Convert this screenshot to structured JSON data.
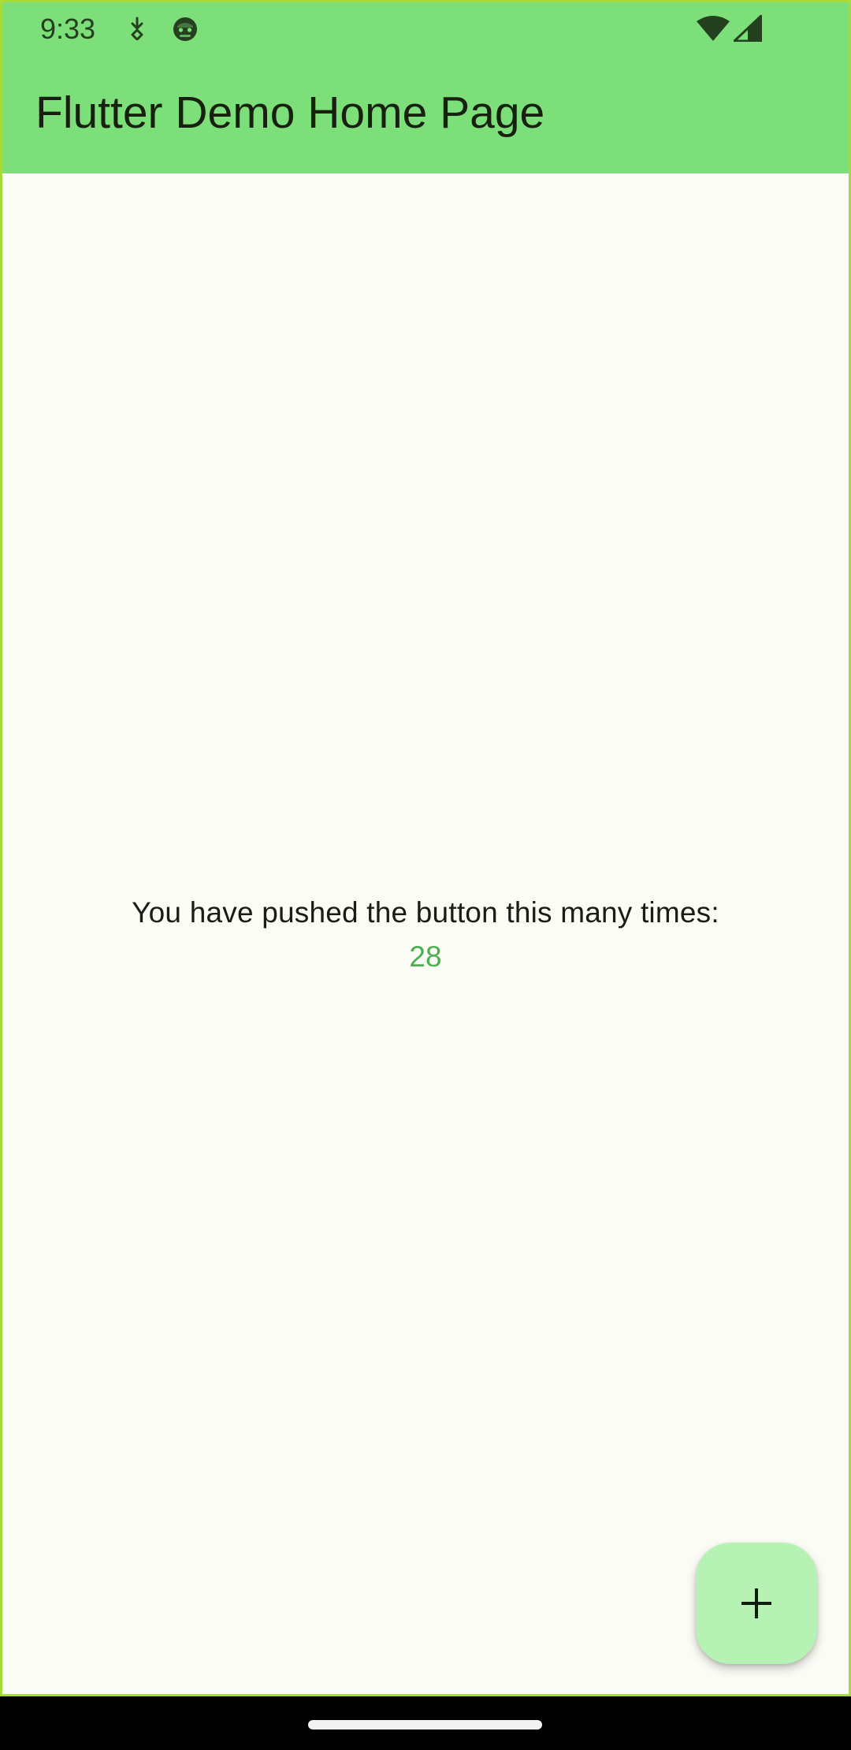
{
  "status_bar": {
    "time": "9:33",
    "notification_icons": [
      "download-arrow-icon",
      "android-robot-icon"
    ],
    "system_icons": [
      "wifi-icon",
      "cellular-signal-icon"
    ]
  },
  "app_bar": {
    "title": "Flutter Demo Home Page",
    "background_color": "#7ddf7a"
  },
  "body": {
    "counter_label": "You have pushed the button this many times:",
    "counter_value": "28",
    "counter_value_color": "#4caf50",
    "background_color": "#fbfcf6"
  },
  "fab": {
    "icon": "plus-icon",
    "background_color": "#b6f2b4"
  },
  "navigation_bar": {
    "handle": "gesture-handle"
  }
}
